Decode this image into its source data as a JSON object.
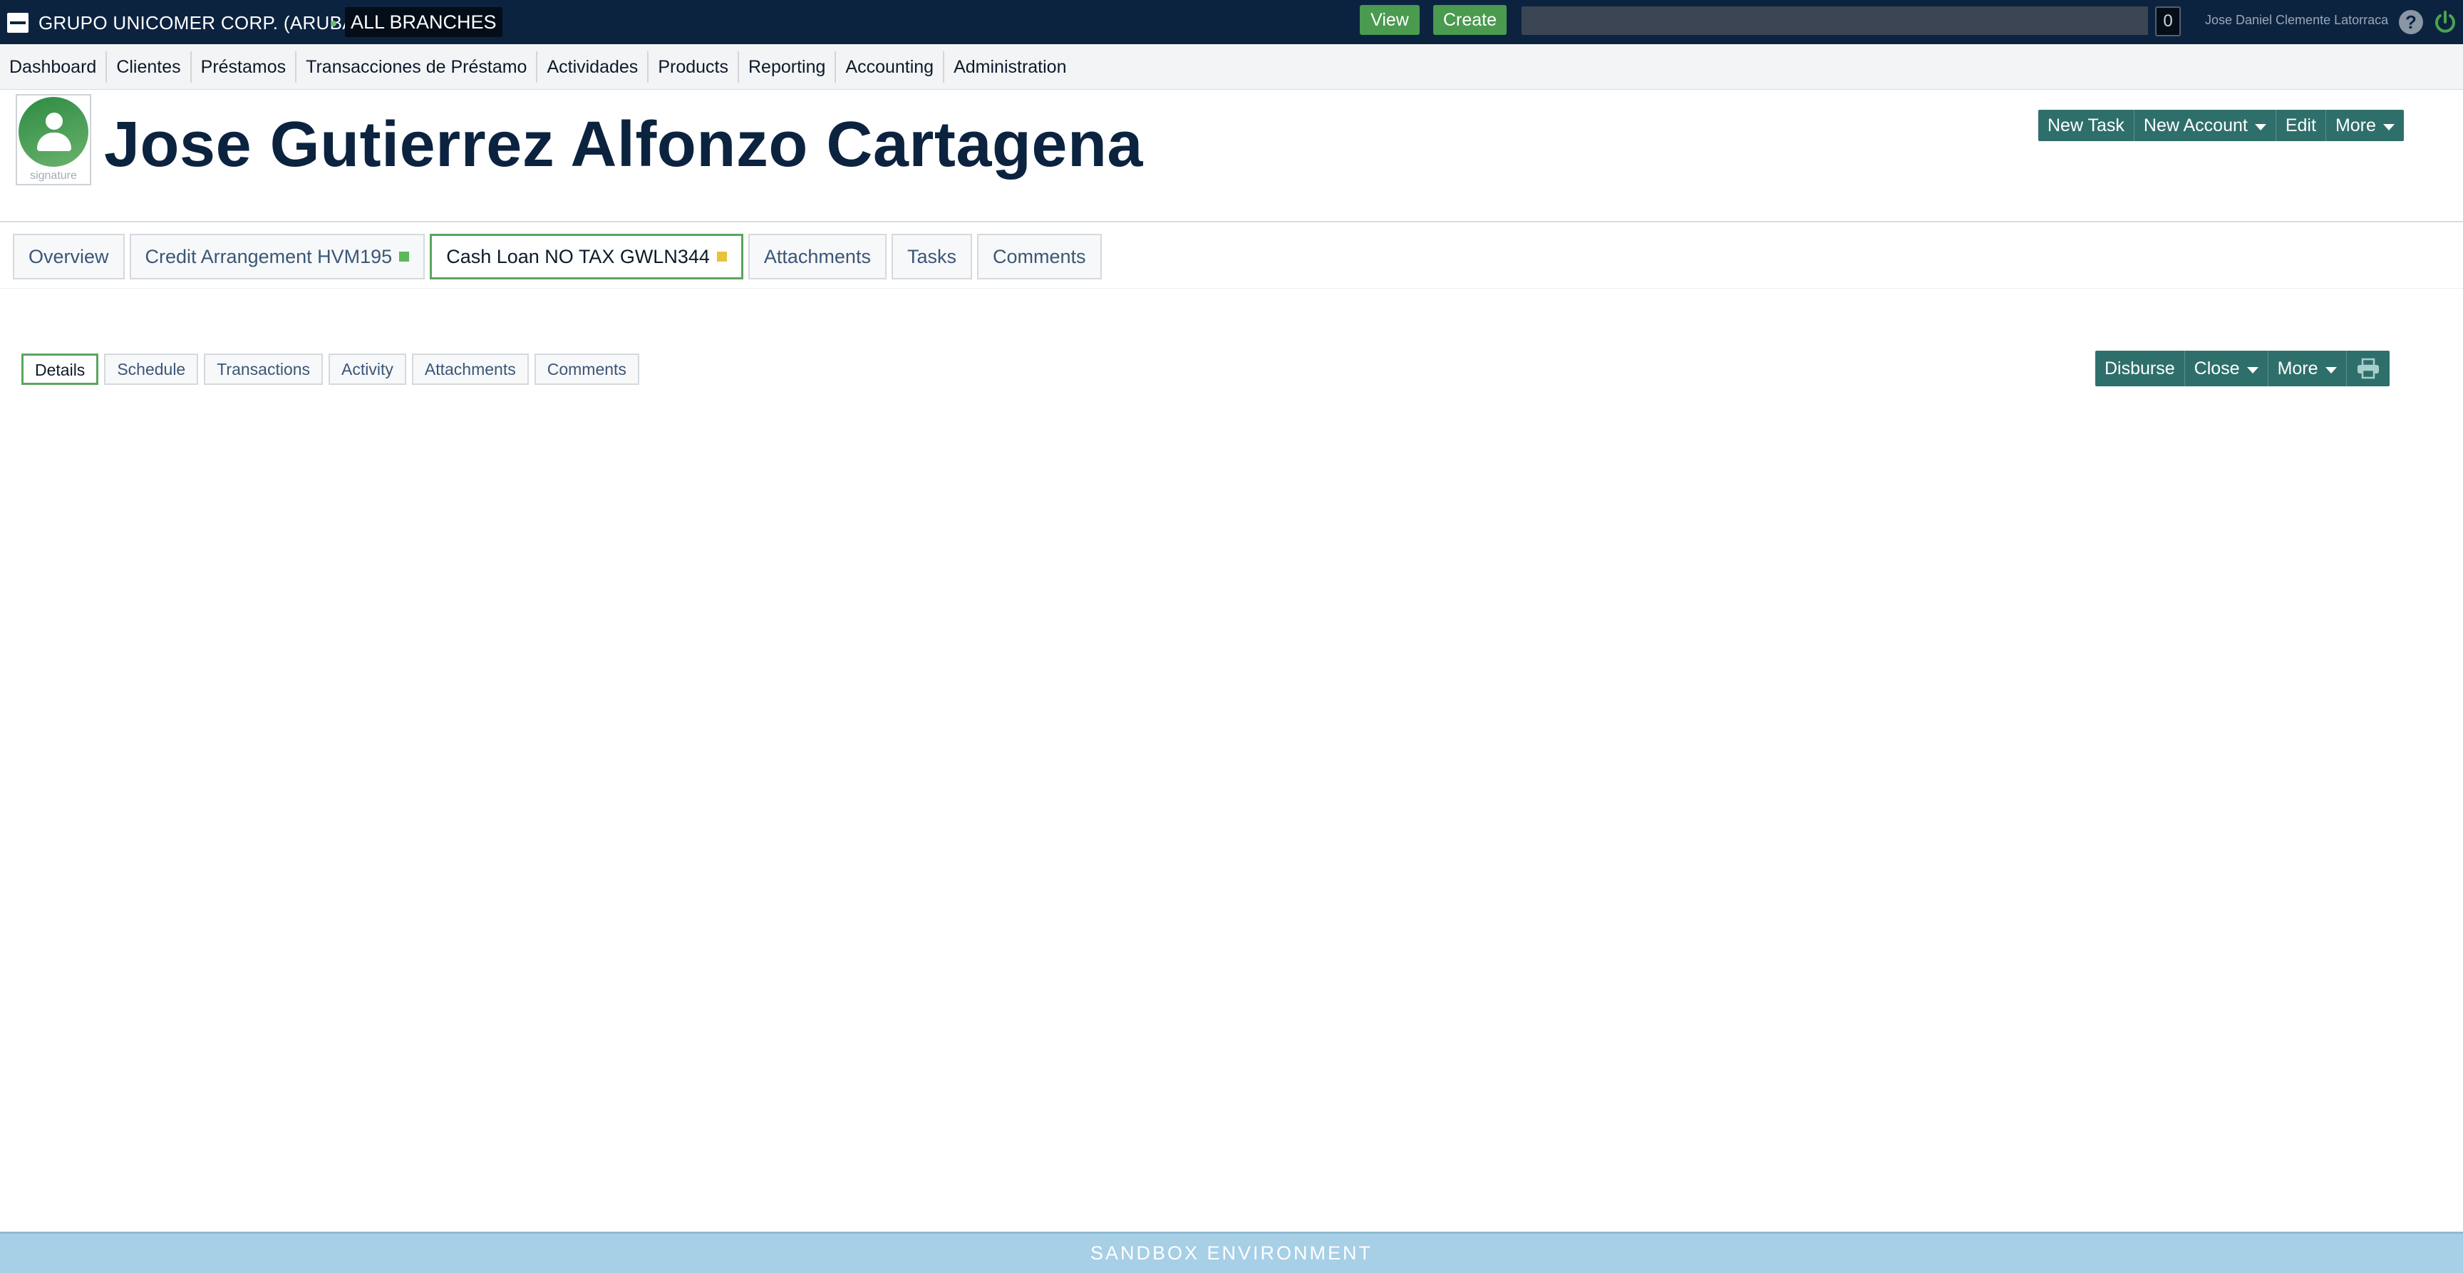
{
  "topbar": {
    "org_name": "GRUPO UNICOMER CORP. (ARUBA)",
    "branch": "ALL BRANCHES",
    "view_label": "View",
    "create_label": "Create",
    "search_value": "",
    "notifications_count": "0",
    "user_name": "Jose Daniel Clemente Latorraca",
    "help_label": "?",
    "accent_color": "#4a9a4f",
    "background_color": "#0c2340"
  },
  "menu": {
    "items": [
      {
        "label": "Dashboard"
      },
      {
        "label": "Clientes"
      },
      {
        "label": "Préstamos"
      },
      {
        "label": "Transacciones de Préstamo"
      },
      {
        "label": "Actividades"
      },
      {
        "label": "Products"
      },
      {
        "label": "Reporting"
      },
      {
        "label": "Accounting"
      },
      {
        "label": "Administration"
      }
    ]
  },
  "header": {
    "client_name": "Jose Gutierrez Alfonzo Cartagena",
    "avatar_caption": "signature",
    "actions": {
      "new_task": "New Task",
      "new_account": "New Account",
      "edit": "Edit",
      "more": "More"
    }
  },
  "tabs": [
    {
      "label": "Overview"
    },
    {
      "label": "Credit Arrangement HVM195",
      "status_color": "#5cb85c"
    },
    {
      "label": "Cash Loan NO TAX GWLN344",
      "status_color": "#e5c43a",
      "active": true
    },
    {
      "label": "Attachments"
    },
    {
      "label": "Tasks"
    },
    {
      "label": "Comments"
    }
  ],
  "subtabs": [
    {
      "label": "Details",
      "active": true
    },
    {
      "label": "Schedule"
    },
    {
      "label": "Transactions"
    },
    {
      "label": "Activity"
    },
    {
      "label": "Attachments"
    },
    {
      "label": "Comments"
    }
  ],
  "loan_actions": {
    "disburse": "Disburse",
    "close": "Close",
    "more": "More",
    "print_icon": "printer-icon"
  },
  "footer": {
    "environment": "SANDBOX ENVIRONMENT",
    "color": "#a7cfe6"
  }
}
